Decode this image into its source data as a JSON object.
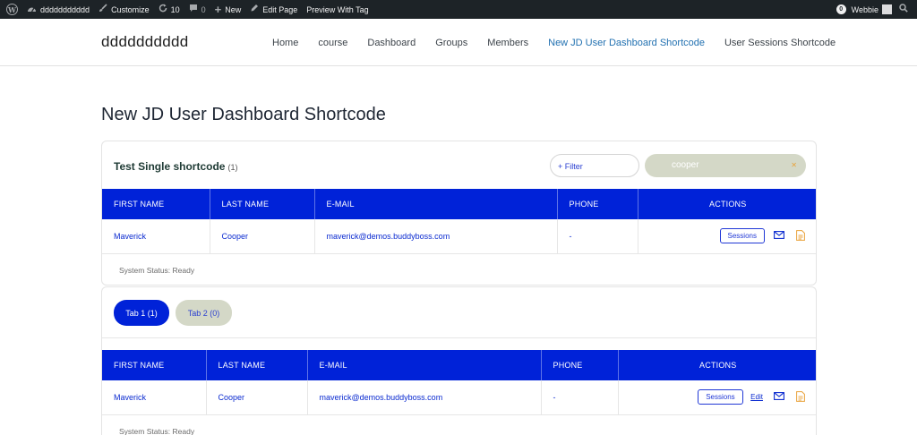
{
  "adminbar": {
    "site_name": "ddddddddddd",
    "customize": "Customize",
    "updates_count": "10",
    "comments_count": "0",
    "new_label": "New",
    "edit_page": "Edit Page",
    "preview": "Preview With Tag",
    "notif_count": "0",
    "user_name": "Webbie"
  },
  "site": {
    "title": "dddddddddd",
    "nav": [
      "Home",
      "course",
      "Dashboard",
      "Groups",
      "Members",
      "New JD User Dashboard Shortcode",
      "User Sessions Shortcode"
    ],
    "active_nav": "New JD User Dashboard Shortcode"
  },
  "page": {
    "title": "New JD User Dashboard Shortcode"
  },
  "card1": {
    "title": "Test Single shortcode",
    "count": "(1)",
    "filter_label": "+ Filter",
    "search_value": "cooper",
    "columns": [
      "FIRST NAME",
      "LAST NAME",
      "E-MAIL",
      "PHONE",
      "ACTIONS"
    ],
    "rows": [
      {
        "first": "Maverick",
        "last": "Cooper",
        "email": "maverick@demos.buddyboss.com",
        "phone": "-",
        "sessions_label": "Sessions"
      }
    ],
    "status": "System Status: Ready"
  },
  "card2": {
    "tabs": [
      "Tab 1 (1)",
      "Tab 2 (0)"
    ],
    "columns": [
      "FIRST NAME",
      "LAST NAME",
      "E-MAIL",
      "PHONE",
      "ACTIONS"
    ],
    "rows": [
      {
        "first": "Maverick",
        "last": "Cooper",
        "email": "maverick@demos.buddyboss.com",
        "phone": "-",
        "sessions_label": "Sessions",
        "edit_label": "Edit"
      }
    ],
    "status": "System Status: Ready"
  },
  "colors": {
    "primary": "#0022d8",
    "muted_pill": "#d4d8c7",
    "link": "#2271b1",
    "adminbar": "#1d2327",
    "accent_orange": "#e9a23b"
  },
  "icons": [
    "wordpress-icon",
    "dashboard-icon",
    "brush-icon",
    "updates-icon",
    "comments-icon",
    "plus-icon",
    "pencil-icon",
    "search-icon",
    "mail-icon",
    "document-icon",
    "clear-icon"
  ]
}
